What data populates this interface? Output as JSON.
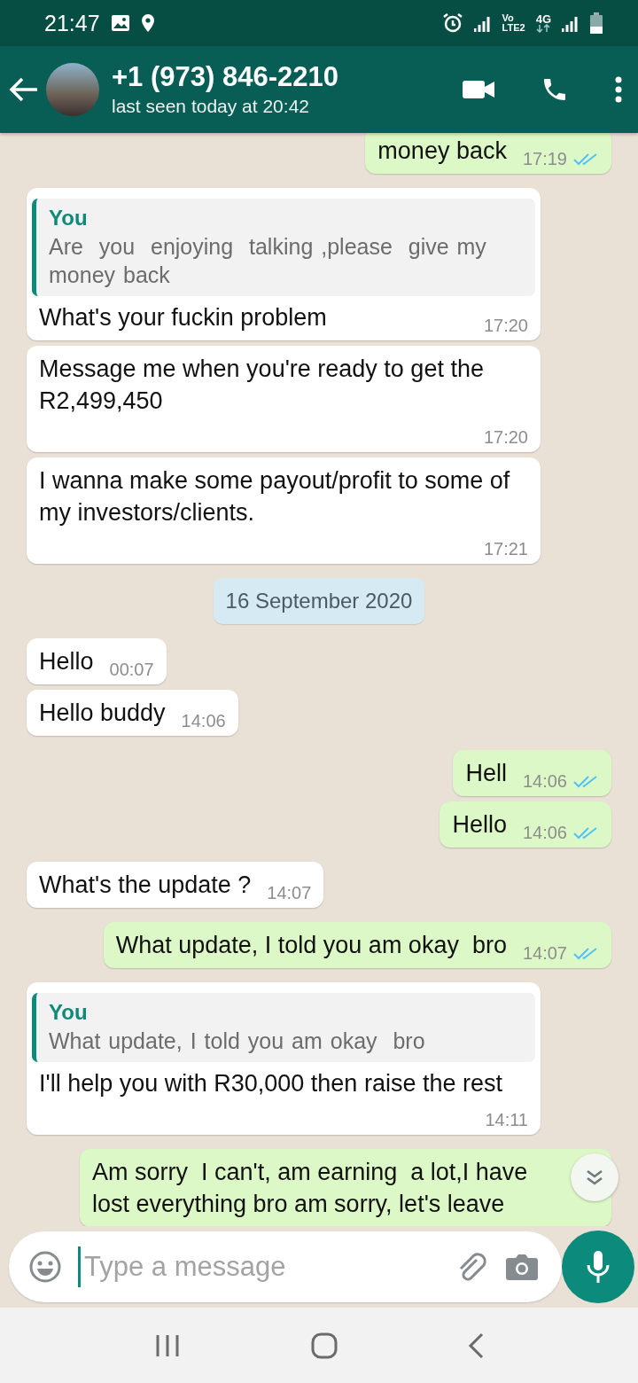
{
  "status_bar": {
    "time": "21:47",
    "network_labels": [
      "Vo",
      "LTE2",
      "4G"
    ]
  },
  "header": {
    "contact": "+1 (973) 846-2210",
    "last_seen": "last seen today at 20:42"
  },
  "messages": [
    {
      "kind": "out",
      "text": "money back",
      "time": "17:19",
      "read": true
    },
    {
      "kind": "in",
      "quote": {
        "author": "You",
        "text": "Are  you  enjoying  talking ,please  give my money back"
      },
      "text": "What's your fuckin problem",
      "time": "17:20"
    },
    {
      "kind": "in",
      "text": "Message me when you're ready to get the R2,499,450",
      "time": "17:20"
    },
    {
      "kind": "in",
      "text": "I wanna make some payout/profit to some of my investors/clients.",
      "time": "17:21"
    },
    {
      "kind": "date",
      "text": "16 September 2020"
    },
    {
      "kind": "in",
      "text": "Hello",
      "time": "00:07"
    },
    {
      "kind": "in",
      "text": "Hello buddy",
      "time": "14:06"
    },
    {
      "kind": "out",
      "text": "Hell",
      "time": "14:06",
      "read": true
    },
    {
      "kind": "out",
      "text": "Hello",
      "time": "14:06",
      "read": true
    },
    {
      "kind": "in",
      "text": "What's the update ?",
      "time": "14:07"
    },
    {
      "kind": "out",
      "text": "What update, I told you am okay  bro",
      "time": "14:07",
      "read": true
    },
    {
      "kind": "in",
      "quote": {
        "author": "You",
        "text": "What update, I told you am okay  bro"
      },
      "text": "I'll help you with R30,000 then raise the rest",
      "time": "14:11"
    },
    {
      "kind": "out",
      "text": "Am sorry  I can't, am earning  a lot,I have lost everything bro am sorry, let's leave"
    }
  ],
  "compose": {
    "placeholder": "Type a message"
  }
}
